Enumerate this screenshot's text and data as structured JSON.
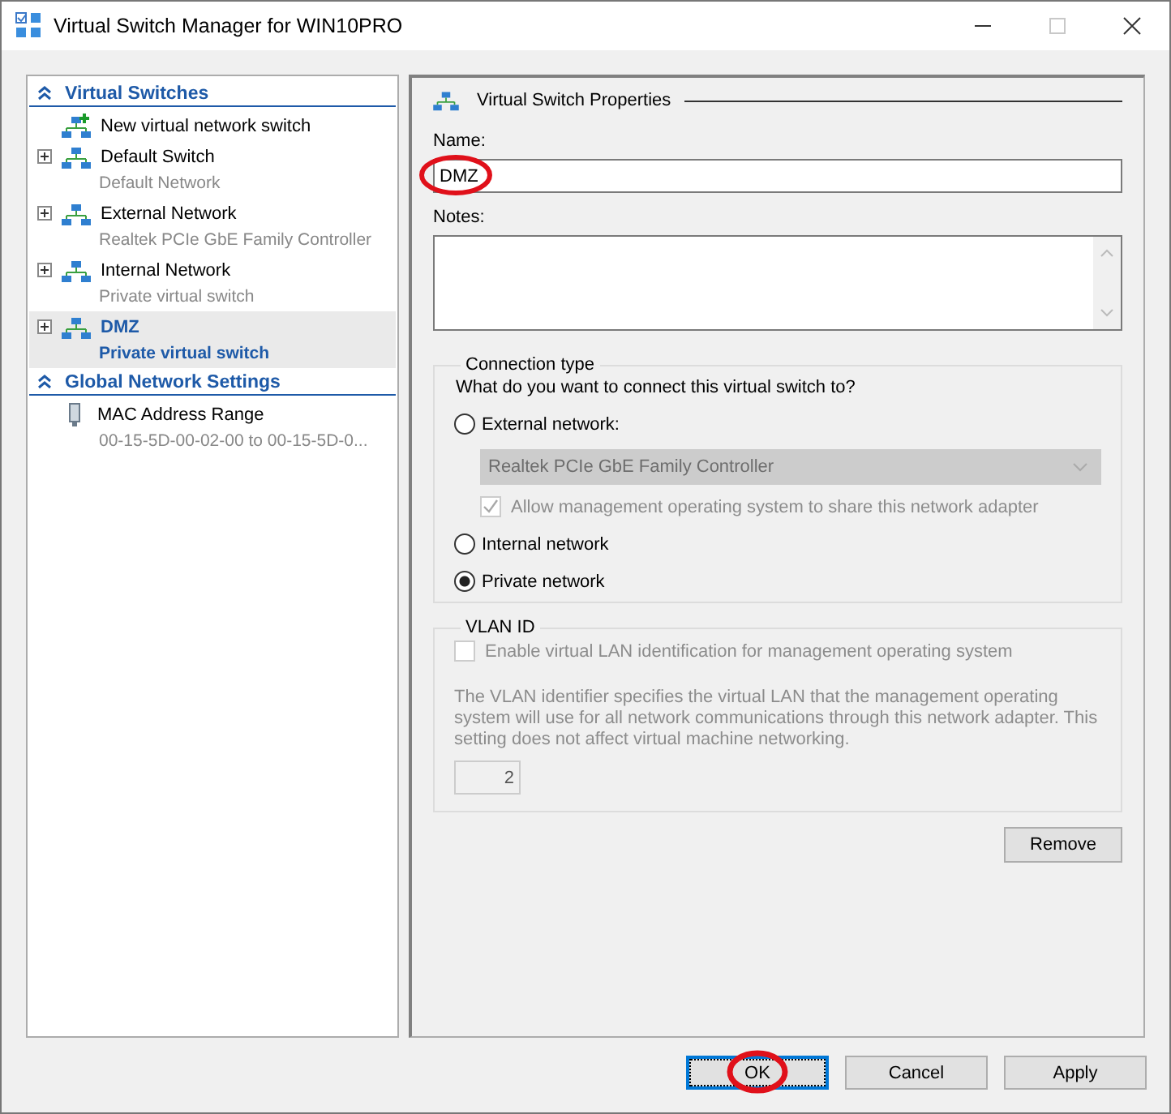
{
  "window": {
    "title": "Virtual Switch Manager for WIN10PRO",
    "maximize_disabled": true
  },
  "sidebar": {
    "items": [
      {
        "kind": "section",
        "label": "Virtual Switches",
        "expanded": true
      },
      {
        "kind": "new",
        "label": "New virtual network switch",
        "selected": false
      },
      {
        "kind": "switch",
        "label": "Default Switch",
        "sub": "Default Network",
        "selected": false
      },
      {
        "kind": "switch",
        "label": "External Network",
        "sub": "Realtek PCIe GbE Family Controller",
        "selected": false
      },
      {
        "kind": "switch",
        "label": "Internal Network",
        "sub": "Private virtual switch",
        "selected": false
      },
      {
        "kind": "switch",
        "label": "DMZ",
        "sub": "Private virtual switch",
        "selected": true
      },
      {
        "kind": "section",
        "label": "Global Network Settings",
        "expanded": true
      },
      {
        "kind": "mac",
        "label": "MAC Address Range",
        "sub": "00-15-5D-00-02-00 to 00-15-5D-0...",
        "selected": false
      }
    ]
  },
  "properties": {
    "title": "Virtual Switch Properties",
    "name_label": "Name:",
    "name_value": "DMZ",
    "name_highlighted": true,
    "notes_label": "Notes:",
    "connection": {
      "legend": "Connection type",
      "question": "What do you want to connect this virtual switch to?",
      "options": [
        {
          "label": "External network:",
          "selected": false,
          "adapter": {
            "value": "Realtek PCIe GbE Family Controller",
            "disabled": true
          },
          "share": {
            "label": "Allow management operating system to share this network adapter",
            "checked": true,
            "disabled": true
          }
        },
        {
          "label": "Internal network",
          "selected": false
        },
        {
          "label": "Private network",
          "selected": true
        }
      ]
    },
    "vlan": {
      "legend": "VLAN ID",
      "enable_label": "Enable virtual LAN identification for management operating system",
      "enable_checked": false,
      "disabled": true,
      "description": "The VLAN identifier specifies the virtual LAN that the management operating system will use for all network communications through this network adapter. This setting does not affect virtual machine networking.",
      "value": "2"
    },
    "remove_label": "Remove"
  },
  "buttons": [
    {
      "label": "OK",
      "default": true,
      "highlighted": true
    },
    {
      "label": "Cancel",
      "default": false,
      "highlighted": false
    },
    {
      "label": "Apply",
      "default": false,
      "highlighted": false
    }
  ]
}
